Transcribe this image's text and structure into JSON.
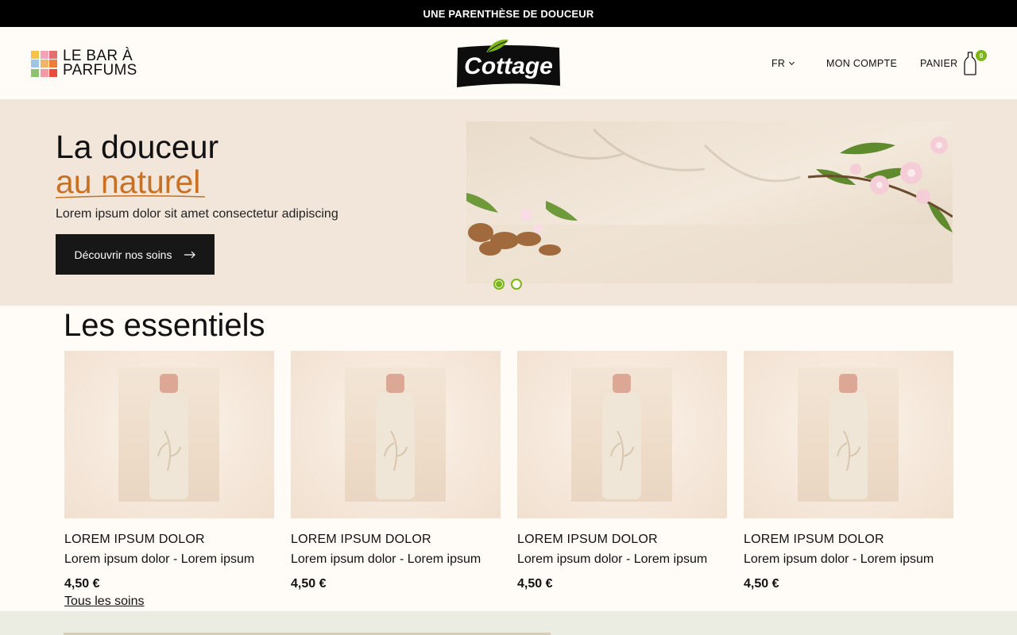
{
  "announcement": "UNE PARENTHÈSE DE DOUCEUR",
  "header": {
    "brand_line1": "LE BAR À",
    "brand_line2": "PARFUMS",
    "logo_text": "Cottage",
    "lang": "FR",
    "account": "MON COMPTE",
    "cart": "PANIER",
    "cart_count": "0"
  },
  "hero": {
    "title_line1": "La douceur",
    "title_line2": "au naturel",
    "subtitle": "Lorem ipsum dolor sit amet consectetur adipiscing",
    "button": "Découvrir nos soins",
    "slide_count": 2,
    "active_slide": 1
  },
  "section": {
    "title": "Les essentiels",
    "all_link": "Tous les soins"
  },
  "products": [
    {
      "name": "LOREM IPSUM DOLOR",
      "desc": "Lorem ipsum dolor - Lorem ipsum",
      "price": "4,50 €"
    },
    {
      "name": "LOREM IPSUM DOLOR",
      "desc": "Lorem ipsum dolor - Lorem ipsum",
      "price": "4,50 €"
    },
    {
      "name": "LOREM IPSUM DOLOR",
      "desc": "Lorem ipsum dolor - Lorem ipsum",
      "price": "4,50 €"
    },
    {
      "name": "LOREM IPSUM DOLOR",
      "desc": "Lorem ipsum dolor - Lorem ipsum",
      "price": "4,50 €"
    }
  ],
  "colors": {
    "accent_green": "#7cb518",
    "accent_orange": "#c67124",
    "hero_bg": "#f2e6da",
    "button_bg": "#171717"
  }
}
